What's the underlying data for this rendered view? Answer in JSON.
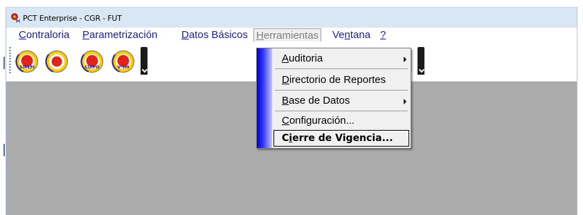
{
  "window": {
    "title": "PCT Enterprise - CGR - FUT",
    "app_icon": "pct-enterprise-icon"
  },
  "menubar": {
    "items": [
      {
        "pre": "",
        "acc": "C",
        "post": "ontraloria"
      },
      {
        "pre": "",
        "acc": "P",
        "post": "arametrización"
      },
      {
        "pre": "",
        "acc": "D",
        "post": "atos Básicos"
      },
      {
        "pre": "",
        "acc": "H",
        "post": "erramientas"
      },
      {
        "pre": "Ve",
        "acc": "n",
        "post": "tana"
      },
      {
        "pre": "",
        "acc": "?",
        "post": ""
      }
    ]
  },
  "toolbar": {
    "buttons": [
      {
        "label": "SIREFI",
        "icon": "sirefi-icon"
      },
      {
        "label": "",
        "icon": "target-icon"
      },
      {
        "label": "CUIPO",
        "icon": "cuipo-icon"
      },
      {
        "label": "V-SM",
        "icon": "v-sm-icon"
      }
    ]
  },
  "dropdown": {
    "items": [
      {
        "pre": "",
        "acc": "A",
        "post": "uditoria",
        "submenu": true
      },
      {
        "pre": "",
        "acc": "D",
        "post": "irectorio de Reportes",
        "submenu": false
      },
      {
        "pre": "",
        "acc": "B",
        "post": "ase de Datos",
        "submenu": true
      },
      {
        "pre": "",
        "acc": "C",
        "post": "onfiguración...",
        "submenu": false
      }
    ],
    "selected": {
      "pre": "C",
      "acc": "i",
      "post": "erre de Vigencia..."
    }
  },
  "colors": {
    "menu_text": "#1a1aa6",
    "client_bg": "#ababab",
    "titlebar_bg": "#d9e6f4"
  }
}
